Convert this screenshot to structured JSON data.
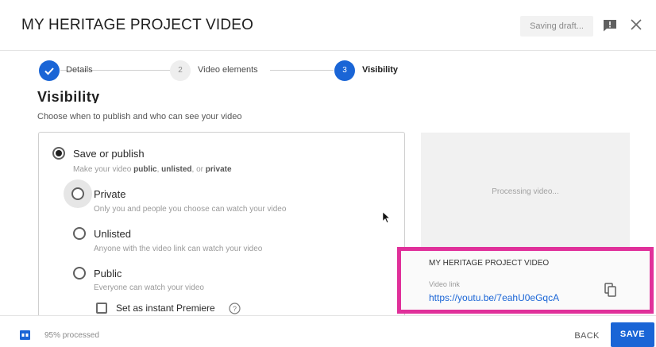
{
  "header": {
    "title": "MY HERITAGE PROJECT VIDEO",
    "saving_status": "Saving draft..."
  },
  "stepper": {
    "steps": [
      {
        "number": "",
        "label": "Details",
        "state": "done"
      },
      {
        "number": "2",
        "label": "Video elements",
        "state": "todo"
      },
      {
        "number": "3",
        "label": "Visibility",
        "state": "active"
      }
    ]
  },
  "visibility": {
    "title": "Visibility",
    "subtitle": "Choose when to publish and who can see your video",
    "save_or_publish": {
      "label": "Save or publish",
      "desc_prefix": "Make your video ",
      "desc_public": "public",
      "desc_sep1": ", ",
      "desc_unlisted": "unlisted",
      "desc_sep2": ", or ",
      "desc_private": "private"
    },
    "options": [
      {
        "label": "Private",
        "desc": "Only you and people you choose can watch your video"
      },
      {
        "label": "Unlisted",
        "desc": "Anyone with the video link can watch your video"
      },
      {
        "label": "Public",
        "desc": "Everyone can watch your video"
      }
    ],
    "premiere_label": "Set as instant Premiere"
  },
  "preview": {
    "processing_text": "Processing video...",
    "video_title": "MY HERITAGE PROJECT VIDEO",
    "link_label": "Video link",
    "link_url": "https://youtu.be/7eahU0eGqcA"
  },
  "footer": {
    "processed_text": "95% processed",
    "back_label": "BACK",
    "save_label": "SAVE"
  },
  "colors": {
    "accent": "#1a65d6",
    "highlight": "#e0309a"
  }
}
